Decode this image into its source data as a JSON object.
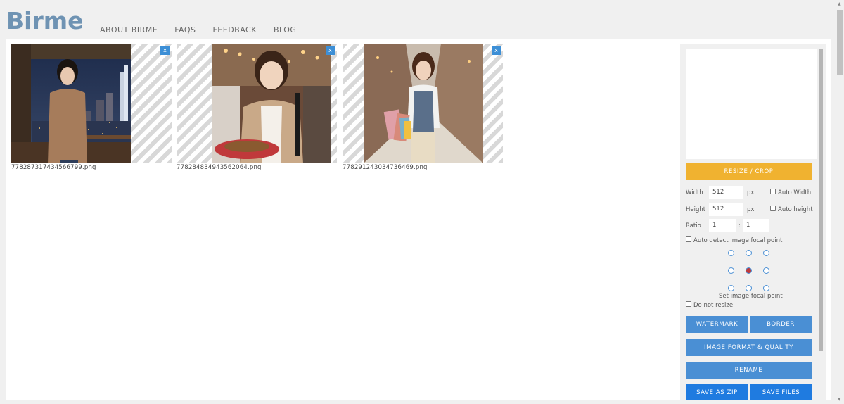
{
  "header": {
    "logo": "Birme",
    "nav": [
      "ABOUT BIRME",
      "FAQS",
      "FEEDBACK",
      "BLOG"
    ]
  },
  "images": [
    {
      "filename": "778287317434566799.png",
      "close": "x"
    },
    {
      "filename": "778284834943562064.png",
      "close": "x"
    },
    {
      "filename": "778291243034736469.png",
      "close": "x"
    }
  ],
  "panel": {
    "resize_button": "RESIZE / CROP",
    "width_label": "Width",
    "width_value": "512",
    "width_unit": "px",
    "auto_width": "Auto Width",
    "height_label": "Height",
    "height_value": "512",
    "height_unit": "px",
    "auto_height": "Auto height",
    "ratio_label": "Ratio",
    "ratio_w": "1",
    "ratio_sep": ":",
    "ratio_h": "1",
    "auto_focal": "Auto detect image focal point",
    "set_focal": "Set image focal point",
    "do_not_resize": "Do not resize",
    "watermark_button": "WATERMARK",
    "border_button": "BORDER",
    "format_button": "IMAGE FORMAT & QUALITY",
    "rename_button": "RENAME",
    "save_zip_button": "SAVE AS ZIP",
    "save_files_button": "SAVE FILES"
  },
  "colors": {
    "logo": "#6f93b3",
    "resize_button": "#f0b230",
    "action_button": "#4a8fd4",
    "close_button": "#3d8fd6",
    "focal_center": "#c0393b"
  }
}
